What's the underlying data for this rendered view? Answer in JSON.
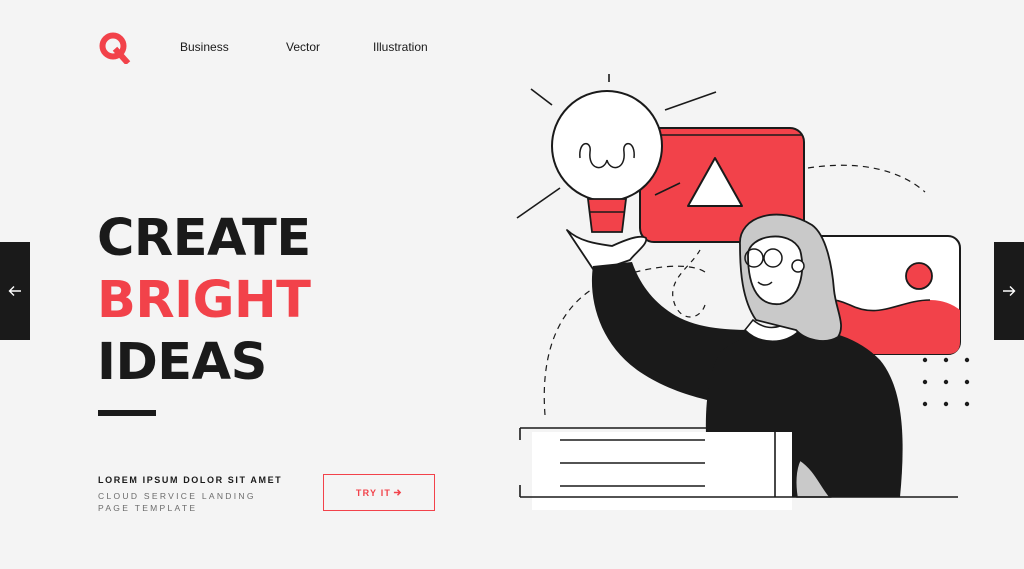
{
  "logo": {
    "letter": "Q",
    "color": "#f2424a"
  },
  "nav": {
    "items": [
      "Business",
      "Vector",
      "Illustration"
    ]
  },
  "hero": {
    "line1": "CREATE",
    "line2": "BRIGHT",
    "line3": "IDEAS"
  },
  "subtitle": "LOREM IPSUM DOLOR SIT AMET",
  "description": "CLOUD SERVICE LANDING PAGE TEMPLATE",
  "cta": {
    "label": "TRY IT",
    "icon": "arrow-right-icon"
  },
  "slider": {
    "prev_icon": "arrow-left-icon",
    "next_icon": "arrow-right-icon"
  },
  "colors": {
    "accent": "#f2424a",
    "dark": "#1a1a1a",
    "background": "#f4f4f4"
  }
}
